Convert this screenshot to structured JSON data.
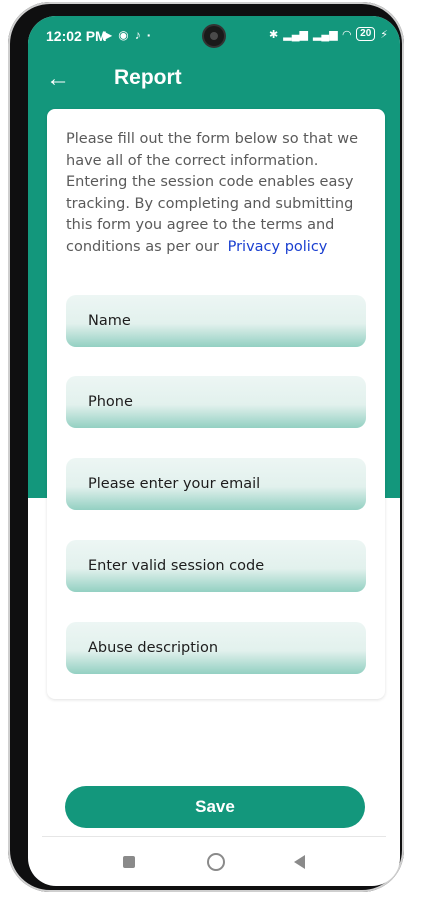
{
  "status_bar": {
    "time": "12:02 PM",
    "icons": [
      "youtube-icon",
      "whatsapp-icon",
      "tiktok-icon",
      "dot-icon",
      "bluetooth-icon",
      "signal-icon",
      "signal-icon",
      "wifi-icon"
    ],
    "volte1": "Vo\nWiFi",
    "volte2": "Vo\nWiFi",
    "battery": "20"
  },
  "app_bar": {
    "title": "Report",
    "back_icon": "arrow-left-icon"
  },
  "form": {
    "intro": "Please fill out the form below so that we have all of the correct information. Entering the session code enables easy tracking. By completing and submitting this form you agree to the terms and conditions as per our",
    "privacy_link": "Privacy policy",
    "fields": {
      "name": "Name",
      "phone": "Phone",
      "email": "Please enter your email",
      "session_code": "Enter valid session code",
      "abuse_description": "Abuse description"
    },
    "save_label": "Save"
  },
  "colors": {
    "primary": "#13977c",
    "link": "#1a3fd0"
  }
}
